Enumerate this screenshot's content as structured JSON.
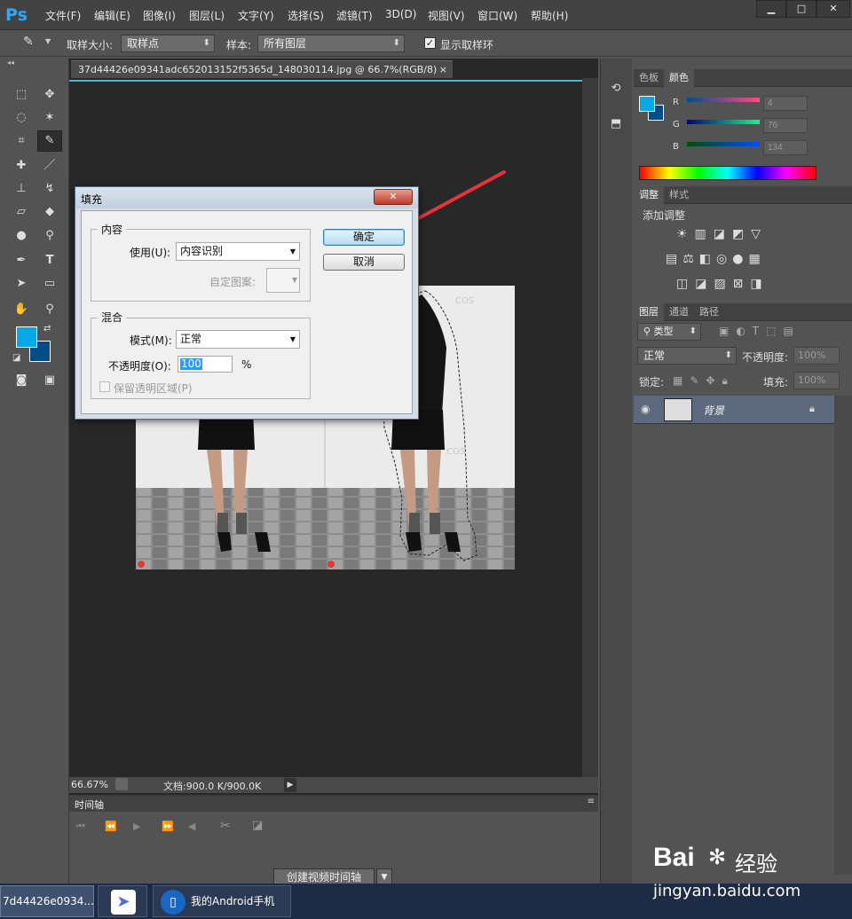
{
  "app": {
    "logo": "Ps"
  },
  "menu": [
    "文件(F)",
    "编辑(E)",
    "图像(I)",
    "图层(L)",
    "文字(Y)",
    "选择(S)",
    "滤镜(T)",
    "3D(D)",
    "视图(V)",
    "窗口(W)",
    "帮助(H)"
  ],
  "window_controls": {
    "minimize": "▁",
    "restore": "□",
    "close": "✕"
  },
  "options": {
    "sample_size_label": "取样大小:",
    "sample_size_value": "取样点",
    "sample_label": "样本:",
    "sample_value": "所有图层",
    "show_ring_label": "显示取样环"
  },
  "document": {
    "tab_title": "37d44426e09341adc652013152f5365d_148030114.jpg @ 66.7%(RGB/8)",
    "close": "×",
    "zoom": "66.67%",
    "doc_info": "文档:900.0 K/900.0K",
    "watermark_text": "COS"
  },
  "timeline": {
    "tab": "时间轴",
    "create_button": "创建视频时间轴"
  },
  "color_panel": {
    "tabs": [
      "色板",
      "颜色"
    ],
    "active": 1,
    "r_label": "R",
    "g_label": "G",
    "b_label": "B",
    "r": "4",
    "g": "76",
    "b": "134",
    "fg": "#07a8e8",
    "bg": "#044c86"
  },
  "adjust_panel": {
    "tabs": [
      "调整",
      "样式"
    ],
    "active": 0,
    "title": "添加调整"
  },
  "layers_panel": {
    "tabs": [
      "图层",
      "通道",
      "路径"
    ],
    "active": 0,
    "filter": "类型",
    "blend": "正常",
    "opacity_label": "不透明度:",
    "opacity": "100%",
    "lock_label": "锁定:",
    "fill_label": "填充:",
    "fill": "100%",
    "layer_name": "背景"
  },
  "dialog": {
    "title": "填充",
    "content_group": "内容",
    "use_label": "使用(U):",
    "use_value": "内容识别",
    "pattern_label": "自定图案:",
    "blend_group": "混合",
    "mode_label": "模式(M):",
    "mode_value": "正常",
    "opacity_label": "不透明度(O):",
    "opacity_value": "100",
    "percent": "%",
    "preserve_label": "保留透明区域(P)",
    "ok": "确定",
    "cancel": "取消"
  },
  "taskbar": {
    "item1": "7d44426e0934...",
    "item3": "我的Android手机"
  },
  "watermark": {
    "brand": "Bai",
    "brand_suffix": "经验",
    "url": "jingyan.baidu.com"
  },
  "colors": {
    "accent": "#31a8ff",
    "arrow": "#e8333a",
    "selection": "#3399ff"
  }
}
